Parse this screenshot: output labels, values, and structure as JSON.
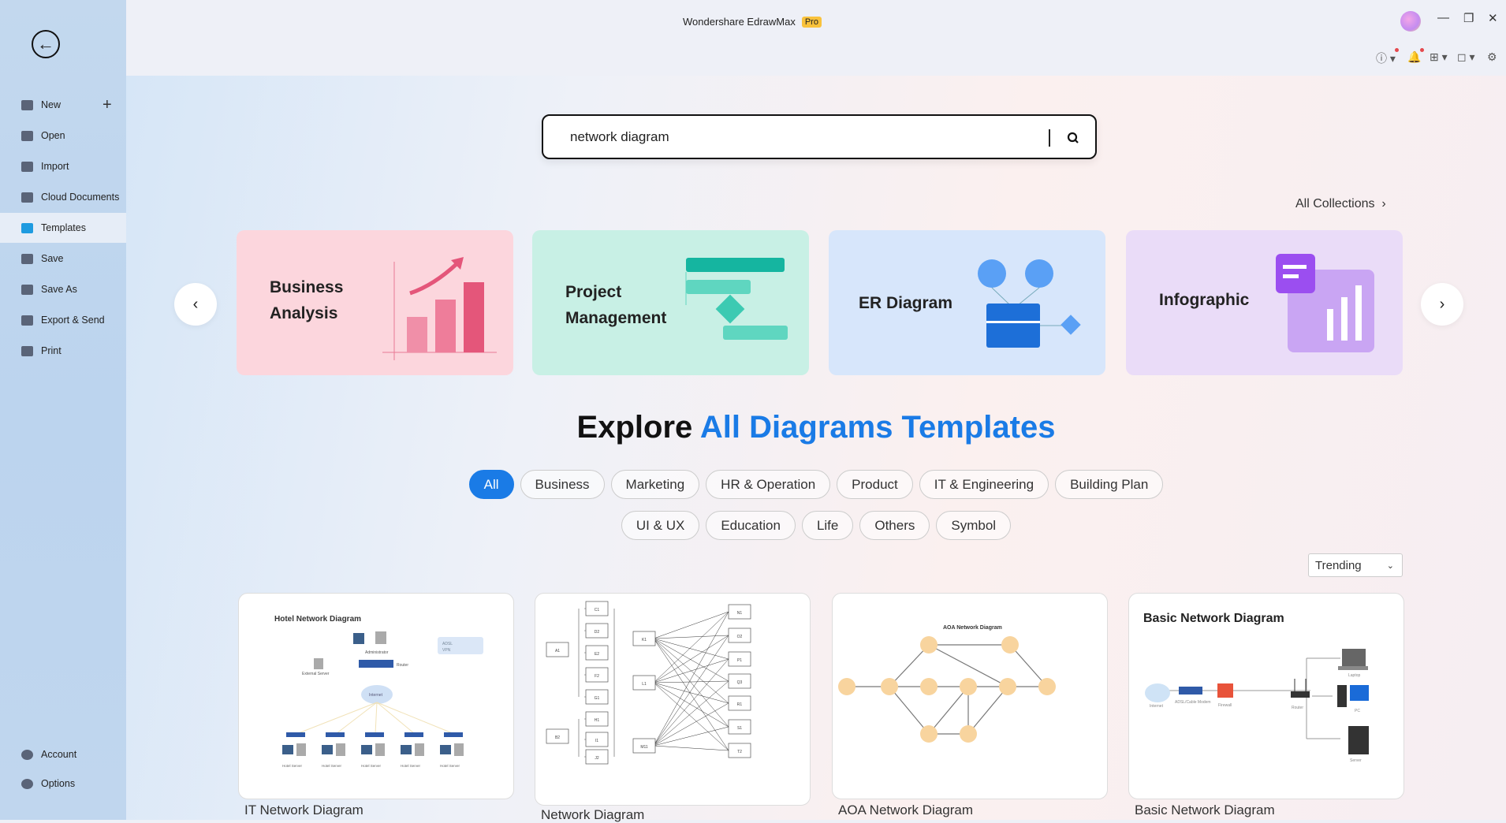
{
  "app": {
    "title": "Wondershare EdrawMax",
    "badge": "Pro"
  },
  "sidebar": {
    "items": [
      {
        "label": "New",
        "icon": "new-icon"
      },
      {
        "label": "Open",
        "icon": "folder-icon"
      },
      {
        "label": "Import",
        "icon": "import-icon"
      },
      {
        "label": "Cloud Documents",
        "icon": "cloud-icon"
      },
      {
        "label": "Templates",
        "icon": "templates-icon",
        "active": true
      },
      {
        "label": "Save",
        "icon": "save-icon"
      },
      {
        "label": "Save As",
        "icon": "save-as-icon"
      },
      {
        "label": "Export & Send",
        "icon": "export-icon"
      },
      {
        "label": "Print",
        "icon": "print-icon"
      }
    ],
    "bottom": [
      {
        "label": "Account",
        "icon": "account-icon"
      },
      {
        "label": "Options",
        "icon": "gear-icon"
      }
    ]
  },
  "search": {
    "value": "network diagram"
  },
  "collections": {
    "link": "All Collections",
    "cards": [
      {
        "label": "Business Analysis",
        "color": "#fcd6dd"
      },
      {
        "label": "Project Management",
        "color": "#c8f0e5"
      },
      {
        "label": "ER Diagram",
        "color": "#d7e6fb"
      },
      {
        "label": "Infographic",
        "color": "#eadcf8"
      }
    ]
  },
  "explore": {
    "title_black": "Explore",
    "title_blue": "All Diagrams Templates",
    "accent": "#1a7be6"
  },
  "filters": {
    "row1": [
      "All",
      "Business",
      "Marketing",
      "HR & Operation",
      "Product",
      "IT & Engineering",
      "Building Plan"
    ],
    "row2": [
      "UI & UX",
      "Education",
      "Life",
      "Others",
      "Symbol"
    ],
    "active": "All"
  },
  "sort": {
    "selected": "Trending"
  },
  "templates": [
    {
      "label": "IT Network Diagram",
      "thumb_title": "Hotel Network Diagram",
      "thumb_labels": [
        "Administrator",
        "Router",
        "External Server",
        "Internet",
        "ADSL",
        "VPN",
        "Hotel Server"
      ]
    },
    {
      "label": "Network Diagram",
      "nodes_left": [
        "A1",
        "B2"
      ],
      "nodes_mid": [
        "C1",
        "D2",
        "E2",
        "F2",
        "G1",
        "H1",
        "I1",
        "J2"
      ],
      "nodes_hub": [
        "K1",
        "L1",
        "M11"
      ],
      "nodes_right": [
        "N1",
        "O2",
        "P1",
        "Q3",
        "R1",
        "S1",
        "T2"
      ]
    },
    {
      "label": "AOA Network Diagram",
      "thumb_title": "AOA Network Diagram"
    },
    {
      "label": "Basic Network Diagram",
      "thumb_title": "Basic Network Diagram",
      "thumb_labels": [
        "Internet",
        "ADSL/Cable Modem",
        "Firewall",
        "Router",
        "Laptop",
        "PC",
        "Server"
      ]
    }
  ]
}
